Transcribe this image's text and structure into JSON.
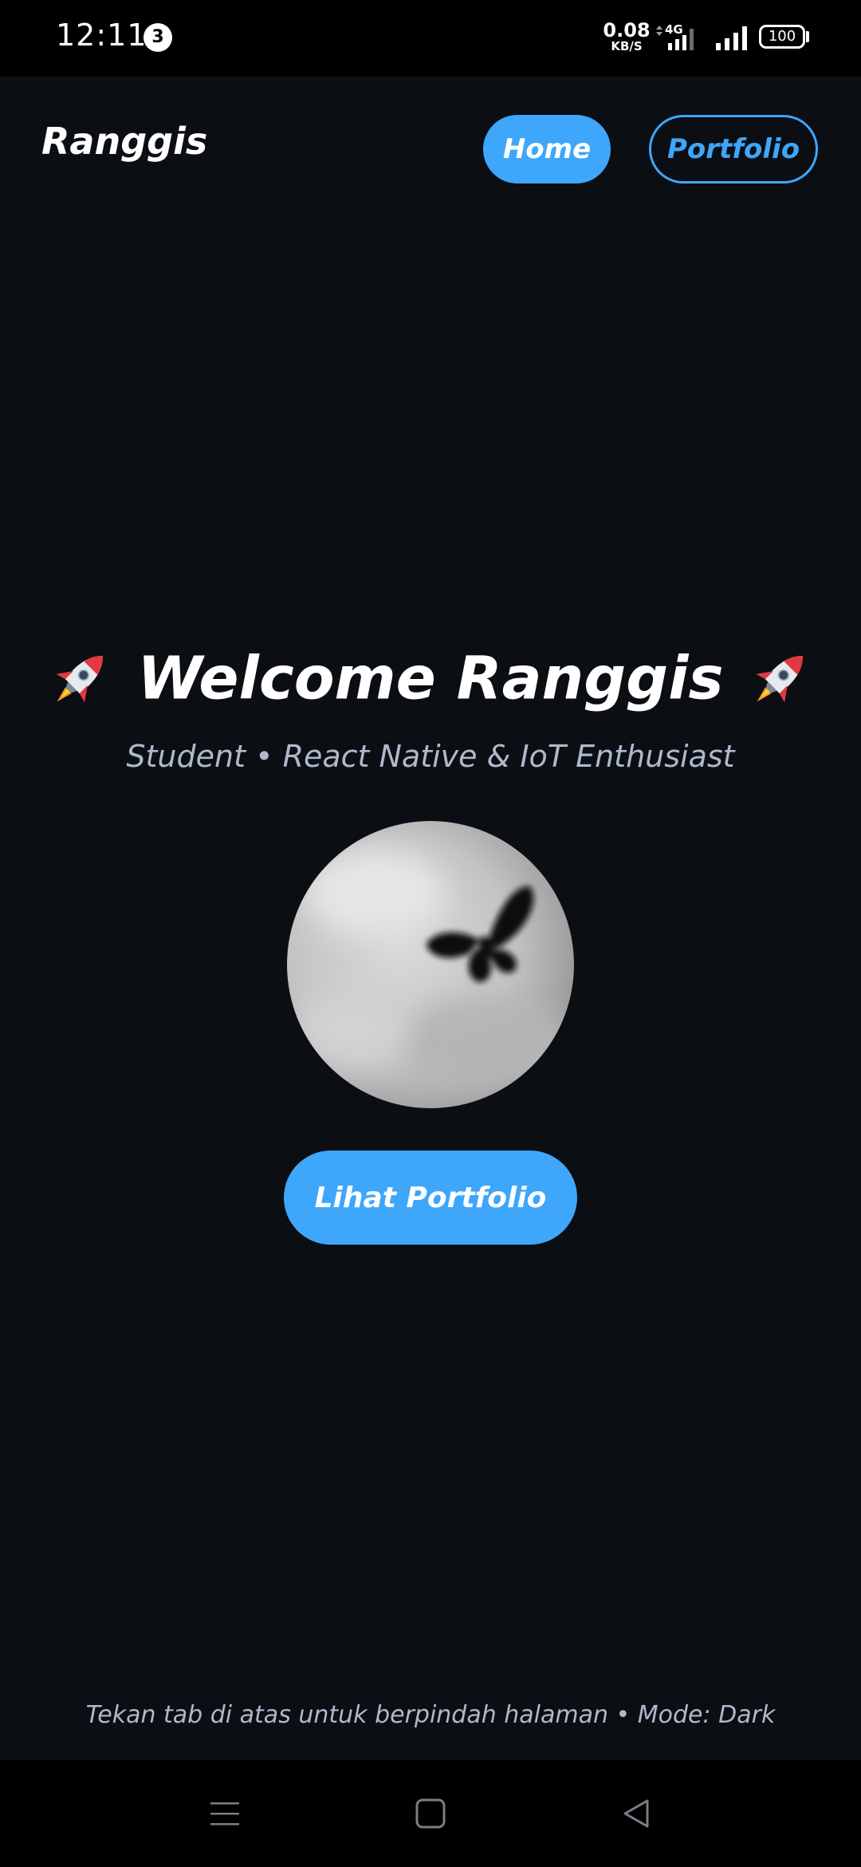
{
  "status_bar": {
    "time": "12:11",
    "notification_count": "3",
    "net_speed_value": "0.08",
    "net_speed_unit": "KB/S",
    "network_type": "4G",
    "battery": "100"
  },
  "header": {
    "brand": "Ranggis",
    "tabs": [
      {
        "label": "Home",
        "active": true
      },
      {
        "label": "Portfolio",
        "active": false
      }
    ]
  },
  "hero": {
    "title": "Welcome Ranggis",
    "title_icon": "rocket-icon",
    "subtitle": "Student • React Native & IoT Enthusiast",
    "cta_label": "Lihat Portfolio"
  },
  "footer": {
    "hint": "Tekan tab di atas untuk berpindah halaman • Mode: Dark"
  },
  "system_nav": {
    "icons": [
      "menu-icon",
      "home-square-icon",
      "back-triangle-icon"
    ]
  },
  "colors": {
    "background": "#0b0e13",
    "accent": "#3ea6fb",
    "text_primary": "#ffffff",
    "text_secondary": "#aeb9cc"
  }
}
